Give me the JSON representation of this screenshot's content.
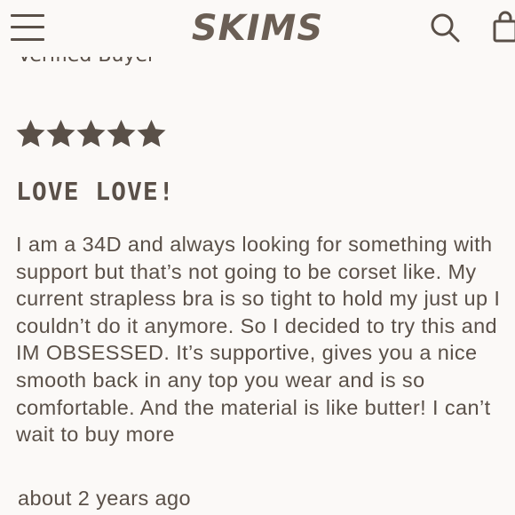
{
  "header": {
    "logo_text": "SKIMS",
    "menu_icon": "hamburger-menu-icon",
    "search_icon": "search-icon",
    "bag_icon": "shopping-bag-icon"
  },
  "review": {
    "reviewer_label": "Verified Buyer",
    "rating": 5,
    "rating_max": 5,
    "title": "LOVE LOVE!",
    "body": "I am a 34D and always looking for something with support but that’s not going to be corset like. My current strapless bra is so tight to hold my just up I couldn’t do it anymore. So I decided to try this and IM OBSESSED. It’s supportive, gives you a nice smooth back in any top you wear and is so comfortable. And the material is like butter! I can’t wait to buy more",
    "date": "about 2 years ago"
  },
  "colors": {
    "background": "#fbf9f7",
    "text": "#5a5048",
    "star": "#5a5048"
  }
}
